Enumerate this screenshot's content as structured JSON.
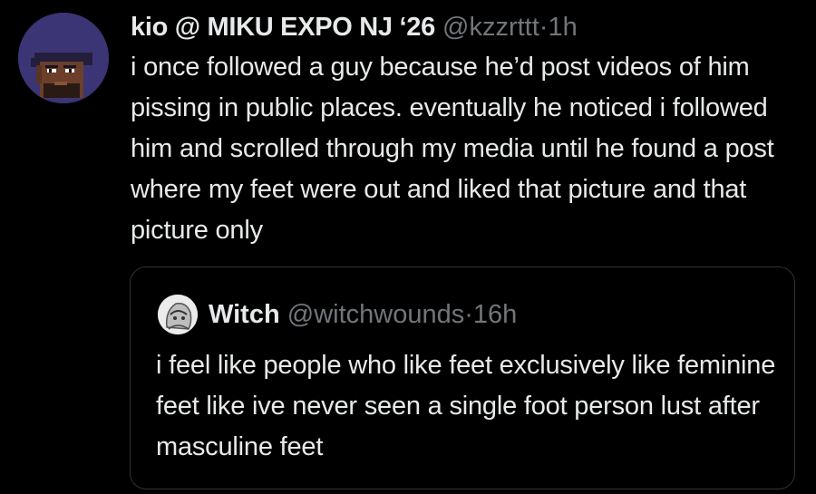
{
  "tweet": {
    "display_name": "kio @ MIKU EXPO NJ ‘26",
    "handle": "@kzzrttt",
    "separator": "·",
    "time": "1h",
    "text": "i once followed a guy because he’d post videos of him pissing in public places. eventually he noticed i followed him and scrolled through my media until he found a post where my feet were out and liked that picture and that picture only",
    "avatar_icon": "pixel-art-character-avatar"
  },
  "quoted_tweet": {
    "display_name": "Witch",
    "handle": "@witchwounds",
    "separator": "·",
    "time": "16h",
    "text": "i feel like people who like feet exclusively like feminine feet like ive never seen a single foot person lust after masculine feet",
    "avatar_icon": "sketch-character-avatar"
  },
  "colors": {
    "background": "#000000",
    "primary_text": "#e7e9ea",
    "secondary_text": "#71767b",
    "border": "#2f3336"
  }
}
